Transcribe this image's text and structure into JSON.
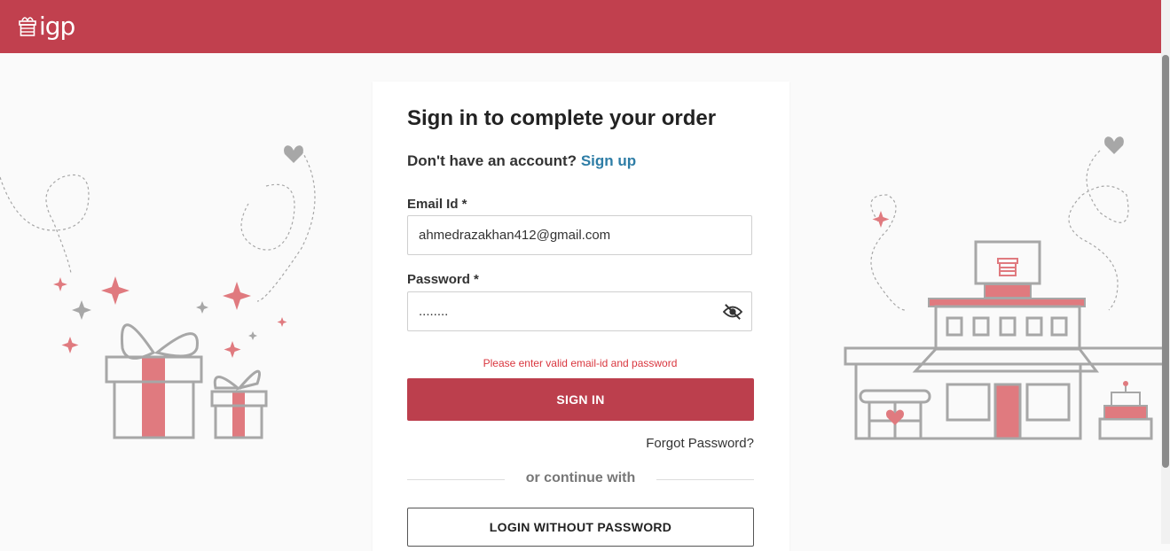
{
  "header": {
    "logo_text": "igp",
    "brand_color": "#c1404e"
  },
  "signin": {
    "title": "Sign in to complete your order",
    "no_account_text": "Don't have an account?",
    "signup_link": "Sign up",
    "email_label": "Email Id *",
    "email_value": "ahmedrazakhan412@gmail.com",
    "password_label": "Password *",
    "password_value": "........",
    "error_message": "Please enter valid email-id and password",
    "signin_button": "SIGN IN",
    "forgot_password": "Forgot Password?",
    "divider_text": "or continue with",
    "login_without_password": "LOGIN WITHOUT PASSWORD"
  },
  "colors": {
    "accent": "#bc3f4d",
    "link": "#2e7da6",
    "error": "#d9363e",
    "illustration_pink": "#e07a7f",
    "illustration_gray": "#a7a7a7"
  },
  "icons": {
    "logo": "gift-icon",
    "password_toggle": "eye-off-icon"
  }
}
